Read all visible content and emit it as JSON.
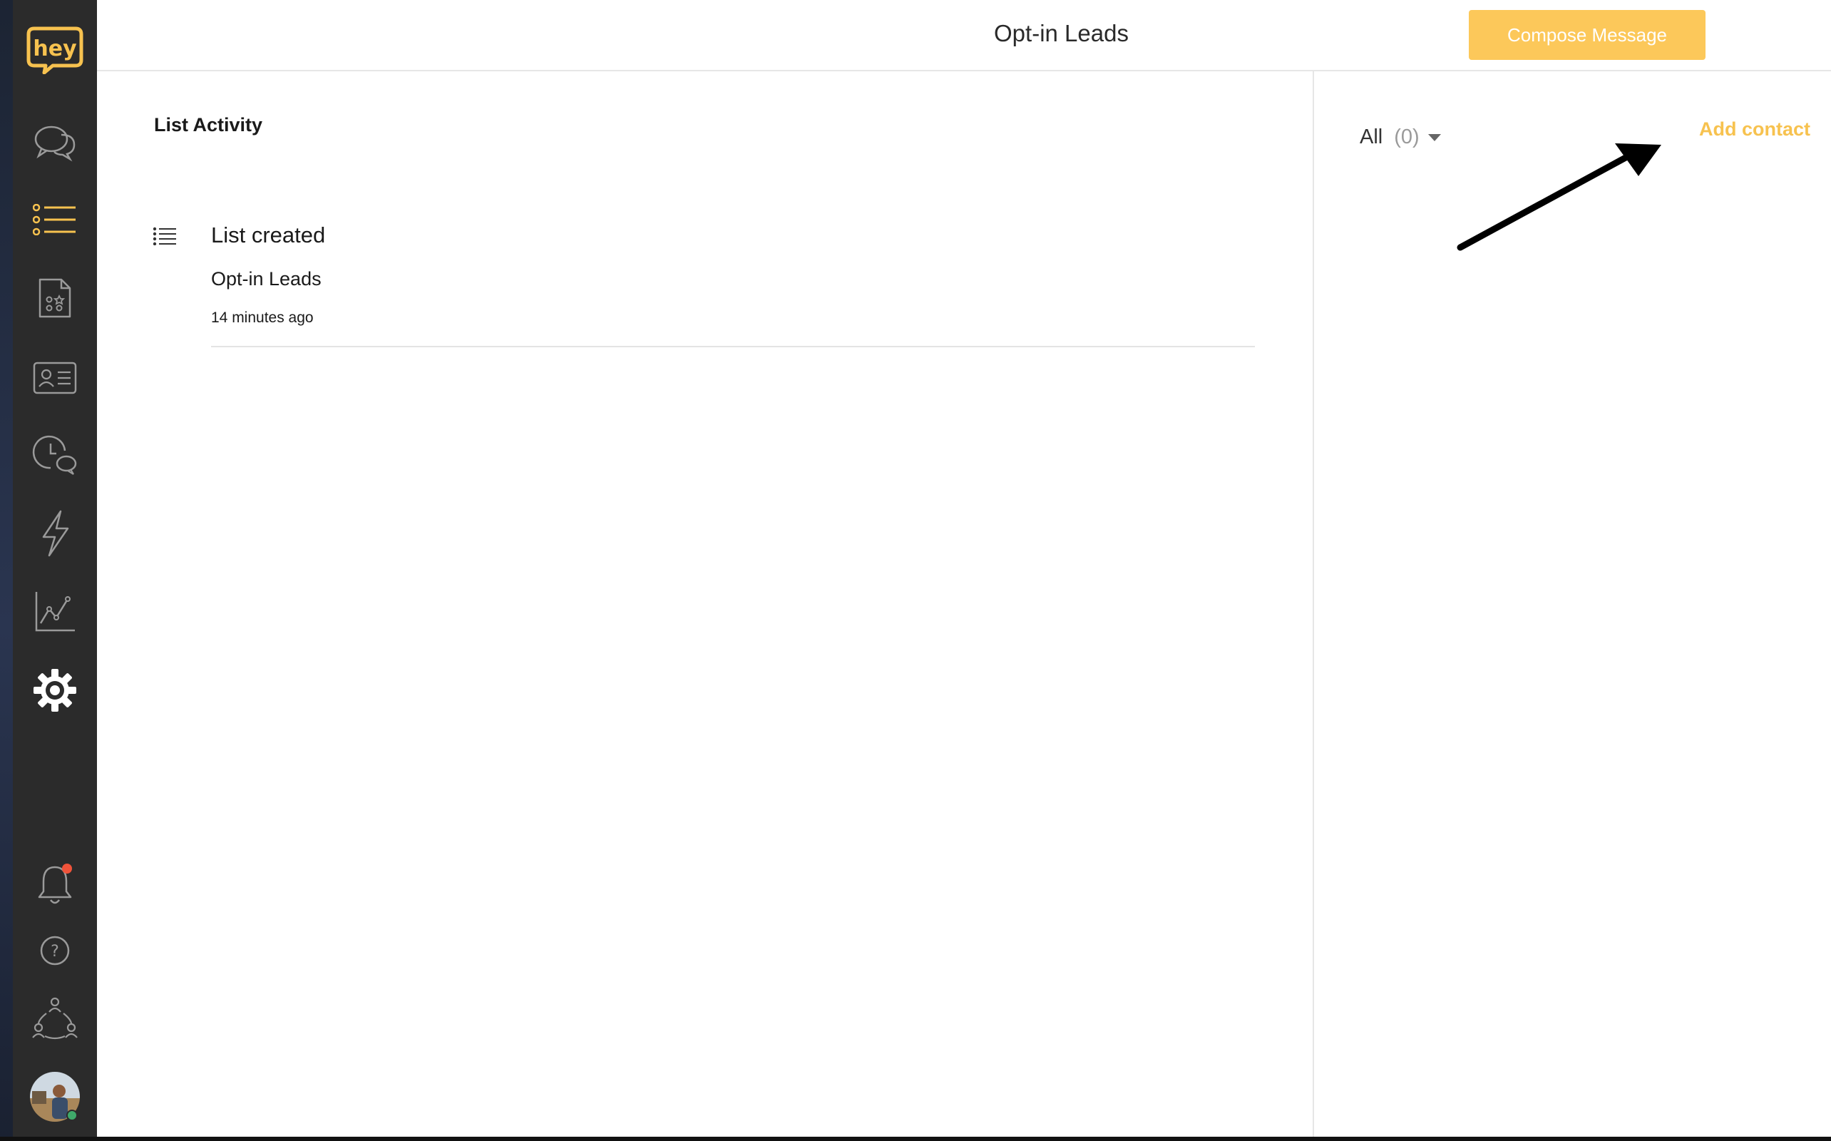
{
  "app": {
    "logo_text": "hey",
    "accent_color": "#fcc85a",
    "sidebar_bg": "#2b2b2b"
  },
  "sidebar": {
    "items": [
      {
        "name": "conversations",
        "icon": "chat-bubbles-icon",
        "active": false
      },
      {
        "name": "lists",
        "icon": "list-icon",
        "active": true
      },
      {
        "name": "forms",
        "icon": "form-document-icon",
        "active": false
      },
      {
        "name": "contacts",
        "icon": "contact-card-icon",
        "active": false
      },
      {
        "name": "scheduled",
        "icon": "clock-chat-icon",
        "active": false
      },
      {
        "name": "automations",
        "icon": "lightning-icon",
        "active": false
      },
      {
        "name": "analytics",
        "icon": "line-chart-icon",
        "active": false
      },
      {
        "name": "settings",
        "icon": "gear-icon",
        "active": false
      }
    ],
    "bottom_items": [
      {
        "name": "notifications",
        "icon": "bell-icon",
        "has_badge": true
      },
      {
        "name": "help",
        "icon": "question-icon"
      },
      {
        "name": "team",
        "icon": "team-icon"
      },
      {
        "name": "profile",
        "icon": "avatar",
        "online": true
      }
    ]
  },
  "header": {
    "title": "Opt-in Leads",
    "compose_label": "Compose Message"
  },
  "activity": {
    "section_title": "List Activity",
    "items": [
      {
        "title": "List created",
        "list_name": "Opt-in Leads",
        "time": "14 minutes ago"
      }
    ]
  },
  "contacts_panel": {
    "filter_label": "All",
    "filter_count": "(0)",
    "add_contact_label": "Add contact"
  }
}
